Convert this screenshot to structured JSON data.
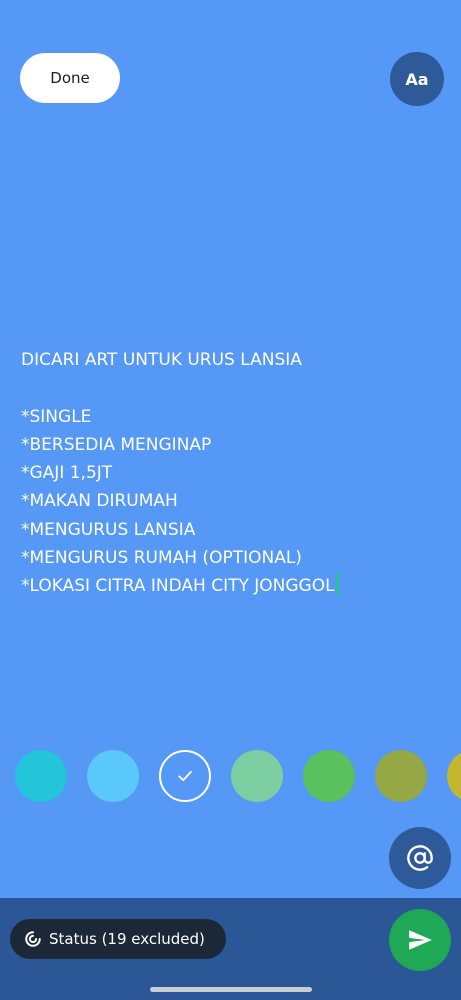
{
  "toolbar": {
    "done_label": "Done",
    "font_label": "Aa"
  },
  "status_text": {
    "lines": [
      "DICARI ART UNTUK URUS LANSIA",
      "",
      "*SINGLE",
      "*BERSEDIA MENGINAP",
      "*GAJI 1,5JT",
      "*MAKAN DIRUMAH",
      "*MENGURUS LANSIA",
      "*MENGURUS RUMAH (OPTIONAL)",
      "*LOKASI CITRA INDAH CITY JONGGOL"
    ]
  },
  "palette": {
    "colors": [
      "#25c5d9",
      "#5ac8fa",
      "#5598f6",
      "#7dcea0",
      "#59c25e",
      "#94a845",
      "#c4b72d"
    ],
    "selected_index": 2
  },
  "icons": {
    "selected_check": "check-icon",
    "mention": "at-sign-icon",
    "audience": "status-ring-icon",
    "send": "send-arrow-icon"
  },
  "footer": {
    "audience_label": "Status (19 excluded)"
  },
  "colors": {
    "background": "#5598f6",
    "accent_dark": "#2f5a9a",
    "bottom_bar": "#2c5796",
    "send": "#1fa855",
    "chip": "#1c2737"
  }
}
